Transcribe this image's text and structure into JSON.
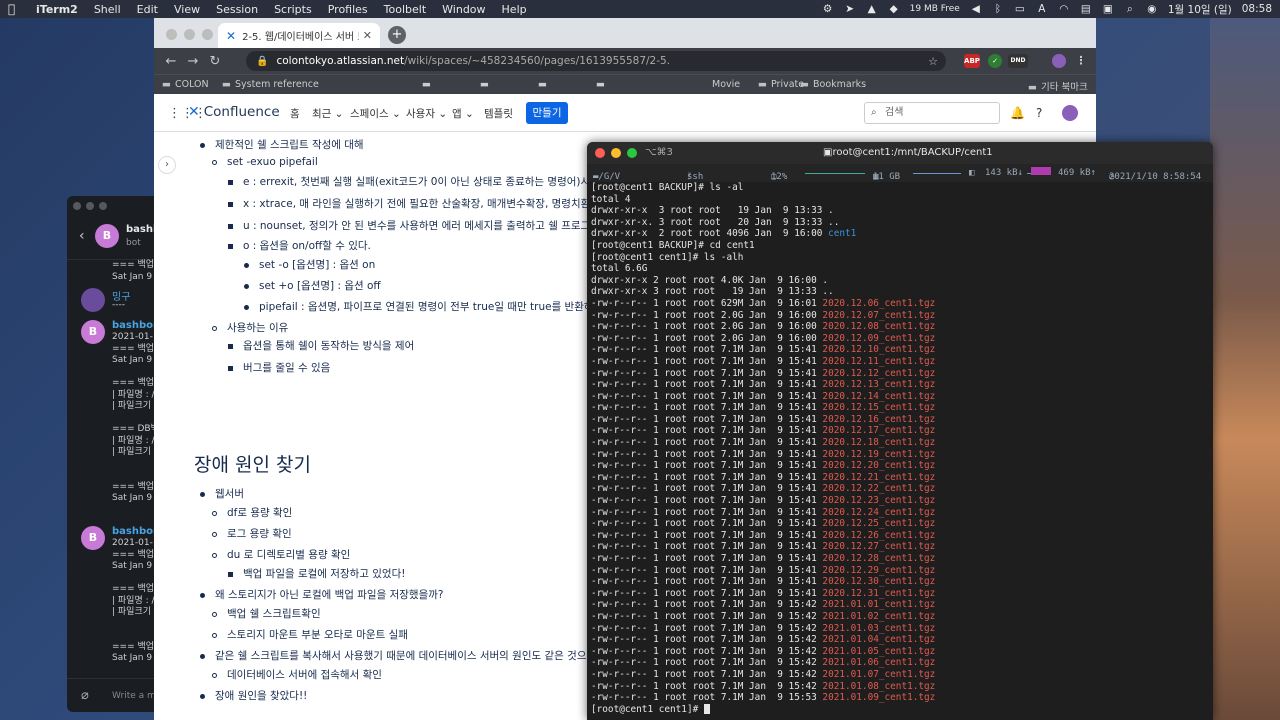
{
  "menubar": {
    "app": "iTerm2",
    "items": [
      "Shell",
      "Edit",
      "View",
      "Session",
      "Scripts",
      "Profiles",
      "Toolbelt",
      "Window",
      "Help"
    ],
    "memory": "19 MB Free",
    "date": "1월 10일 (일)",
    "time": "08:58"
  },
  "slack": {
    "channel": "bashb",
    "channel_sub": "bot",
    "avatar_letter": "B",
    "msg1": [
      "=== 백업",
      "Sat Jan  9"
    ],
    "user2": "밍구",
    "user2_text": "----",
    "user3": "bashbom",
    "msg3": [
      "2021-01-",
      "=== 백업시",
      "Sat Jan  9",
      "",
      "=== 백업 파",
      " | 파일명 : /",
      " | 파일크기",
      "",
      "=== DB백",
      " | 파일명 : /",
      " | 파일크기",
      "",
      "",
      "=== 백업종",
      "Sat Jan  9"
    ],
    "user4": "bashbom",
    "msg4": [
      "2021-01-",
      "=== 백업시",
      "Sat Jan  9",
      "",
      "=== 백업 파",
      " | 파일명 : /",
      " | 파일크기",
      "",
      "",
      "=== 백업종",
      "Sat Jan  9"
    ],
    "input_placeholder": "Write a m"
  },
  "browser": {
    "tab_title": "2-5. 웹/데이터베이스 서버 트러블",
    "url_host": "colontokyo.atlassian.net",
    "url_path": "/wiki/spaces/~458234560/pages/1613955587/2-5.",
    "bookmarks": [
      "COLON",
      "System reference",
      "Movie",
      "Private",
      "Bookmarks",
      "기타 북마크"
    ],
    "ext_labels": [
      "ABP",
      "DND"
    ]
  },
  "confluence": {
    "logo": "Confluence",
    "nav": [
      "홈",
      "최근",
      "스페이스",
      "사용자",
      "앱",
      "템플릿"
    ],
    "create": "만들기",
    "search_placeholder": "검색"
  },
  "doc": {
    "l1": "제한적인 쉘 스크립트 작성에 대해",
    "l2": "set -exuo pipefail",
    "l3": "e : errexit, 첫번째 실행 실패(exit코드가 0이 아닌 상태로 종료하는 명령어)시 쉘",
    "l4": "x : xtrace, 매 라인을 실행하기 전에 필요한 산술확장, 매개변수확장, 명령치환, 변",
    "l5": "u : nounset, 정의가 안 된 변수를 사용하면 에러 메세지를 출력하고 쉘 프로그램",
    "l6": "o : 옵션을 on/off할 수 있다.",
    "l7": "set -o [옵션명] : 옵션 on",
    "l8": "set +o [옵션명] : 옵션 off",
    "l9": "pipefail : 옵션명, 파이프로 연결된 명령이 전부 true일 때만 true를 반환하도",
    "l10": "사용하는 이유",
    "l11": "옵션을 통해 쉘이 동작하는 방식을 제어",
    "l12": "버그를 줄일 수 있음",
    "heading": "장애 원인 찾기",
    "m1": "웹서버",
    "m2": "df로 용량 확인",
    "m3": "로그 용량 확인",
    "m4": "du 로 디렉토리별 용량 확인",
    "m5": "백업 파일을 로컬에 저장하고 있었다!",
    "m6": "왜 스토리지가 아닌 로컬에 백업 파일을 저장했을까?",
    "m7": "백업 쉘 스크립트확인",
    "m8": "스토리지 마운트 부분 오타로 마운트 실패",
    "m9": "같은 쉘 스크립트를 복사해서 사용했기 때문에 데이터베이스 서버의 원인도 같은 것으로 예",
    "m10": "데이터베이스 서버에 접속해서 확인",
    "m11": "장애 원인을 찾았다!!"
  },
  "iterm": {
    "shortcut": "⌥⌘3",
    "title": "root@cent1:/mnt/BACKUP/cent1",
    "status": {
      "path": "~/G/V",
      "ssh": "ssh",
      "cpu": "12%",
      "disk": "11 GB",
      "net_in": "143 kB↓",
      "net_out": "469 kB↑",
      "clock": "2021/1/10 8:58:54"
    },
    "lines": [
      {
        "t": "[root@cent1 BACKUP]# ls -al"
      },
      {
        "t": "total 4"
      },
      {
        "t": "drwxr-xr-x  3 root root   19 Jan  9 13:33 ."
      },
      {
        "t": "drwxr-xr-x. 3 root root   20 Jan  9 13:33 .."
      },
      {
        "t": "drwxr-xr-x  2 root root 4096 Jan  9 16:00 ",
        "d": "cent1"
      },
      {
        "t": "[root@cent1 BACKUP]# cd cent1"
      },
      {
        "t": "[root@cent1 cent1]# ls -alh"
      },
      {
        "t": "total 6.6G"
      },
      {
        "t": "drwxr-xr-x 2 root root 4.0K Jan  9 16:00 ."
      },
      {
        "t": "drwxr-xr-x 3 root root   19 Jan  9 13:33 .."
      },
      {
        "t": "-rw-r--r-- 1 root root 629M Jan  9 16:01 ",
        "f": "2020.12.06_cent1.tgz"
      },
      {
        "t": "-rw-r--r-- 1 root root 2.0G Jan  9 16:00 ",
        "f": "2020.12.07_cent1.tgz"
      },
      {
        "t": "-rw-r--r-- 1 root root 2.0G Jan  9 16:00 ",
        "f": "2020.12.08_cent1.tgz"
      },
      {
        "t": "-rw-r--r-- 1 root root 2.0G Jan  9 16:00 ",
        "f": "2020.12.09_cent1.tgz"
      },
      {
        "t": "-rw-r--r-- 1 root root 7.1M Jan  9 15:41 ",
        "f": "2020.12.10_cent1.tgz"
      },
      {
        "t": "-rw-r--r-- 1 root root 7.1M Jan  9 15:41 ",
        "f": "2020.12.11_cent1.tgz"
      },
      {
        "t": "-rw-r--r-- 1 root root 7.1M Jan  9 15:41 ",
        "f": "2020.12.12_cent1.tgz"
      },
      {
        "t": "-rw-r--r-- 1 root root 7.1M Jan  9 15:41 ",
        "f": "2020.12.13_cent1.tgz"
      },
      {
        "t": "-rw-r--r-- 1 root root 7.1M Jan  9 15:41 ",
        "f": "2020.12.14_cent1.tgz"
      },
      {
        "t": "-rw-r--r-- 1 root root 7.1M Jan  9 15:41 ",
        "f": "2020.12.15_cent1.tgz"
      },
      {
        "t": "-rw-r--r-- 1 root root 7.1M Jan  9 15:41 ",
        "f": "2020.12.16_cent1.tgz"
      },
      {
        "t": "-rw-r--r-- 1 root root 7.1M Jan  9 15:41 ",
        "f": "2020.12.17_cent1.tgz"
      },
      {
        "t": "-rw-r--r-- 1 root root 7.1M Jan  9 15:41 ",
        "f": "2020.12.18_cent1.tgz"
      },
      {
        "t": "-rw-r--r-- 1 root root 7.1M Jan  9 15:41 ",
        "f": "2020.12.19_cent1.tgz"
      },
      {
        "t": "-rw-r--r-- 1 root root 7.1M Jan  9 15:41 ",
        "f": "2020.12.20_cent1.tgz"
      },
      {
        "t": "-rw-r--r-- 1 root root 7.1M Jan  9 15:41 ",
        "f": "2020.12.21_cent1.tgz"
      },
      {
        "t": "-rw-r--r-- 1 root root 7.1M Jan  9 15:41 ",
        "f": "2020.12.22_cent1.tgz"
      },
      {
        "t": "-rw-r--r-- 1 root root 7.1M Jan  9 15:41 ",
        "f": "2020.12.23_cent1.tgz"
      },
      {
        "t": "-rw-r--r-- 1 root root 7.1M Jan  9 15:41 ",
        "f": "2020.12.24_cent1.tgz"
      },
      {
        "t": "-rw-r--r-- 1 root root 7.1M Jan  9 15:41 ",
        "f": "2020.12.25_cent1.tgz"
      },
      {
        "t": "-rw-r--r-- 1 root root 7.1M Jan  9 15:41 ",
        "f": "2020.12.26_cent1.tgz"
      },
      {
        "t": "-rw-r--r-- 1 root root 7.1M Jan  9 15:41 ",
        "f": "2020.12.27_cent1.tgz"
      },
      {
        "t": "-rw-r--r-- 1 root root 7.1M Jan  9 15:41 ",
        "f": "2020.12.28_cent1.tgz"
      },
      {
        "t": "-rw-r--r-- 1 root root 7.1M Jan  9 15:41 ",
        "f": "2020.12.29_cent1.tgz"
      },
      {
        "t": "-rw-r--r-- 1 root root 7.1M Jan  9 15:41 ",
        "f": "2020.12.30_cent1.tgz"
      },
      {
        "t": "-rw-r--r-- 1 root root 7.1M Jan  9 15:41 ",
        "f": "2020.12.31_cent1.tgz"
      },
      {
        "t": "-rw-r--r-- 1 root root 7.1M Jan  9 15:42 ",
        "f": "2021.01.01_cent1.tgz"
      },
      {
        "t": "-rw-r--r-- 1 root root 7.1M Jan  9 15:42 ",
        "f": "2021.01.02_cent1.tgz"
      },
      {
        "t": "-rw-r--r-- 1 root root 7.1M Jan  9 15:42 ",
        "f": "2021.01.03_cent1.tgz"
      },
      {
        "t": "-rw-r--r-- 1 root root 7.1M Jan  9 15:42 ",
        "f": "2021.01.04_cent1.tgz"
      },
      {
        "t": "-rw-r--r-- 1 root root 7.1M Jan  9 15:42 ",
        "f": "2021.01.05_cent1.tgz"
      },
      {
        "t": "-rw-r--r-- 1 root root 7.1M Jan  9 15:42 ",
        "f": "2021.01.06_cent1.tgz"
      },
      {
        "t": "-rw-r--r-- 1 root root 7.1M Jan  9 15:42 ",
        "f": "2021.01.07_cent1.tgz"
      },
      {
        "t": "-rw-r--r-- 1 root root 7.1M Jan  9 15:42 ",
        "f": "2021.01.08_cent1.tgz"
      },
      {
        "t": "-rw-r--r-- 1 root root 7.1M Jan  9 15:53 ",
        "f": "2021.01.09_cent1.tgz"
      },
      {
        "t": "[root@cent1 cent1]# ",
        "c": true
      }
    ]
  }
}
